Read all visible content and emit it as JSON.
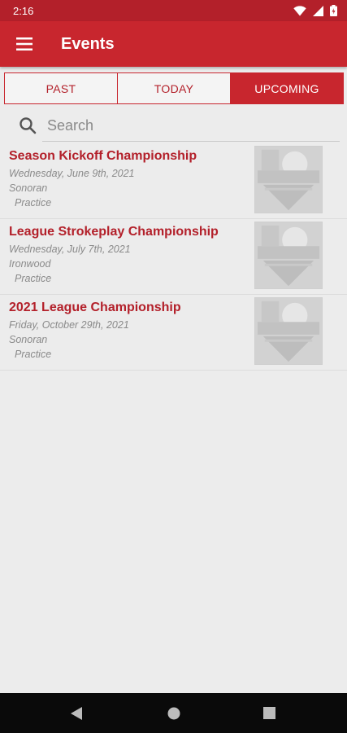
{
  "status_bar": {
    "time": "2:16"
  },
  "app_bar": {
    "title": "Events"
  },
  "tabs": [
    {
      "label": "PAST",
      "active": false
    },
    {
      "label": "TODAY",
      "active": false
    },
    {
      "label": "UPCOMING",
      "active": true
    }
  ],
  "search": {
    "placeholder": "Search",
    "value": ""
  },
  "events": [
    {
      "title": "Season Kickoff Championship",
      "date": "Wednesday, June 9th, 2021",
      "course": "Sonoran",
      "type": "Practice"
    },
    {
      "title": "League Strokeplay Championship",
      "date": "Wednesday, July 7th, 2021",
      "course": "Ironwood",
      "type": "Practice"
    },
    {
      "title": "2021 League Championship",
      "date": "Friday, October 29th, 2021",
      "course": "Sonoran",
      "type": "Practice"
    }
  ],
  "colors": {
    "primary": "#c8262e",
    "status_bar": "#b3202a",
    "title_text": "#b3202a",
    "background": "#ececec"
  },
  "icons": {
    "menu": "hamburger-menu-icon",
    "search": "search-icon",
    "wifi": "wifi-icon",
    "signal": "signal-icon",
    "battery": "battery-icon",
    "back": "back-triangle-icon",
    "home": "home-circle-icon",
    "recents": "recents-square-icon"
  }
}
